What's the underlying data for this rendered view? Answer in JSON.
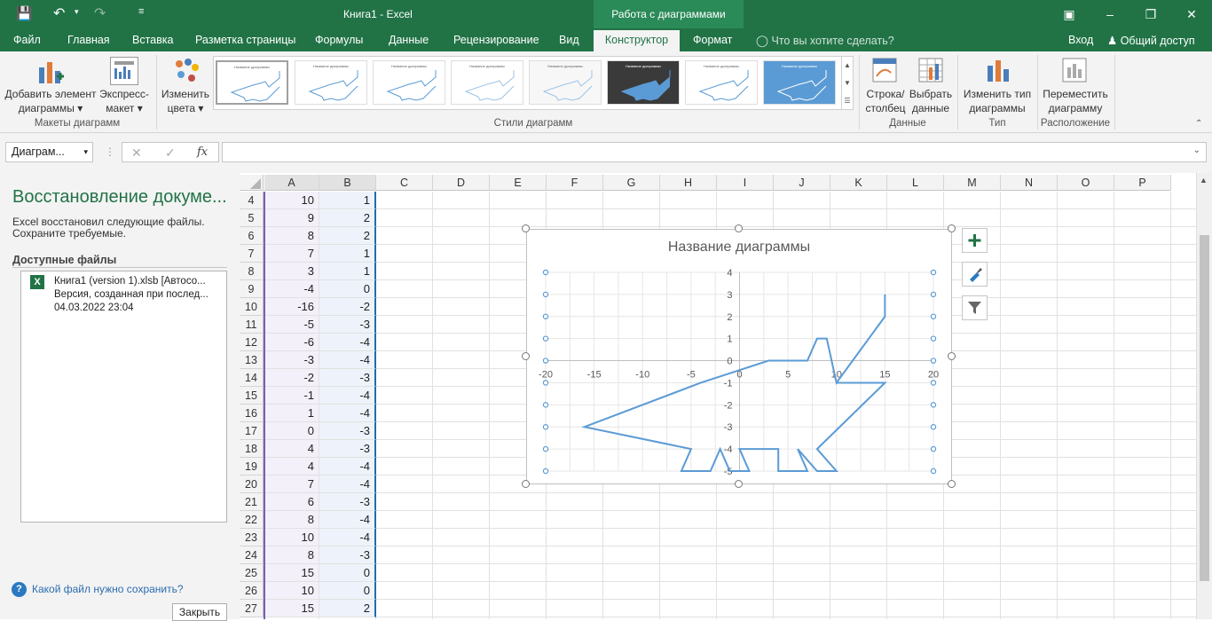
{
  "window": {
    "title": "Книга1 - Excel",
    "context_tab": "Работа с диаграммами",
    "tabs": [
      "Файл",
      "Главная",
      "Вставка",
      "Разметка страницы",
      "Формулы",
      "Данные",
      "Рецензирование",
      "Вид",
      "Конструктор",
      "Формат"
    ],
    "active_tab": "Конструктор",
    "tell_me": "Что вы хотите сделать?",
    "signin": "Вход",
    "share": "Общий доступ"
  },
  "ribbon": {
    "add_element": "Добавить элемент",
    "add_element2": "диаграммы",
    "quick_layout": "Экспресс-",
    "quick_layout2": "макет",
    "change_colors": "Изменить",
    "change_colors2": "цвета",
    "group_layouts": "Макеты диаграмм",
    "group_styles": "Стили диаграмм",
    "switch_row": "Строка/",
    "switch_row2": "столбец",
    "select_data": "Выбрать",
    "select_data2": "данные",
    "group_data": "Данные",
    "change_type": "Изменить тип",
    "change_type2": "диаграммы",
    "group_type": "Тип",
    "move_chart": "Переместить",
    "move_chart2": "диаграмму",
    "group_location": "Расположение",
    "style_labels": [
      "Название диаграммы",
      "Название диаграммы",
      "Название диаграммы",
      "Название диаграммы",
      "Название диаграммы",
      "Название диаграммы",
      "Название диаграммы",
      "Название диаграммы"
    ]
  },
  "formula_bar": {
    "name_box": "Диаграм...",
    "fx": "fx"
  },
  "recovery": {
    "title": "Восстановление докуме...",
    "desc1": "Excel восстановил следующие файлы.",
    "desc2": "Сохраните требуемые.",
    "available": "Доступные файлы",
    "file_name": "Книга1 (version 1).xlsb  [Автосо...",
    "file_version": "Версия, созданная при послед...",
    "file_date": "04.03.2022 23:04",
    "help": "Какой файл нужно сохранить?",
    "close": "Закрыть"
  },
  "sheet": {
    "columns": [
      "A",
      "B",
      "C",
      "D",
      "E",
      "F",
      "G",
      "H",
      "I",
      "J",
      "K",
      "L",
      "M",
      "N",
      "O",
      "P"
    ],
    "rows": [
      {
        "n": "4",
        "a": "10",
        "b": "1"
      },
      {
        "n": "5",
        "a": "9",
        "b": "2"
      },
      {
        "n": "6",
        "a": "8",
        "b": "2"
      },
      {
        "n": "7",
        "a": "7",
        "b": "1"
      },
      {
        "n": "8",
        "a": "3",
        "b": "1"
      },
      {
        "n": "9",
        "a": "-4",
        "b": "0"
      },
      {
        "n": "10",
        "a": "-16",
        "b": "-2"
      },
      {
        "n": "11",
        "a": "-5",
        "b": "-3"
      },
      {
        "n": "12",
        "a": "-6",
        "b": "-4"
      },
      {
        "n": "13",
        "a": "-3",
        "b": "-4"
      },
      {
        "n": "14",
        "a": "-2",
        "b": "-3"
      },
      {
        "n": "15",
        "a": "-1",
        "b": "-4"
      },
      {
        "n": "16",
        "a": "1",
        "b": "-4"
      },
      {
        "n": "17",
        "a": "0",
        "b": "-3"
      },
      {
        "n": "18",
        "a": "4",
        "b": "-3"
      },
      {
        "n": "19",
        "a": "4",
        "b": "-4"
      },
      {
        "n": "20",
        "a": "7",
        "b": "-4"
      },
      {
        "n": "21",
        "a": "6",
        "b": "-3"
      },
      {
        "n": "22",
        "a": "8",
        "b": "-4"
      },
      {
        "n": "23",
        "a": "10",
        "b": "-4"
      },
      {
        "n": "24",
        "a": "8",
        "b": "-3"
      },
      {
        "n": "25",
        "a": "15",
        "b": "0"
      },
      {
        "n": "26",
        "a": "10",
        "b": "0"
      },
      {
        "n": "27",
        "a": "15",
        "b": "2"
      }
    ]
  },
  "chart_data": {
    "type": "scatter",
    "title": "Название диаграммы",
    "xlim": [
      -20,
      20
    ],
    "ylim": [
      -5,
      4
    ],
    "x_ticks": [
      "-20",
      "-15",
      "-10",
      "-5",
      "0",
      "5",
      "10",
      "15",
      "20"
    ],
    "y_ticks": [
      "4",
      "3",
      "2",
      "1",
      "0",
      "-1",
      "-2",
      "-3",
      "-4",
      "-5"
    ],
    "grid": true,
    "color": "#5b9bd5",
    "series": [
      {
        "points": [
          [
            15,
            3
          ],
          [
            15,
            2
          ],
          [
            10,
            -1
          ],
          [
            9,
            1
          ],
          [
            8,
            1
          ],
          [
            7,
            0
          ],
          [
            3,
            0
          ],
          [
            -4,
            -1
          ],
          [
            -16,
            -3
          ],
          [
            -5,
            -4
          ],
          [
            -6,
            -5
          ],
          [
            -3,
            -5
          ],
          [
            -2,
            -4
          ],
          [
            -1,
            -5
          ],
          [
            1,
            -5
          ],
          [
            0,
            -4
          ],
          [
            4,
            -4
          ],
          [
            4,
            -5
          ],
          [
            7,
            -5
          ],
          [
            6,
            -4
          ],
          [
            8,
            -5
          ],
          [
            10,
            -5
          ],
          [
            8,
            -4
          ],
          [
            15,
            -1
          ],
          [
            10,
            -1
          ]
        ]
      }
    ]
  }
}
